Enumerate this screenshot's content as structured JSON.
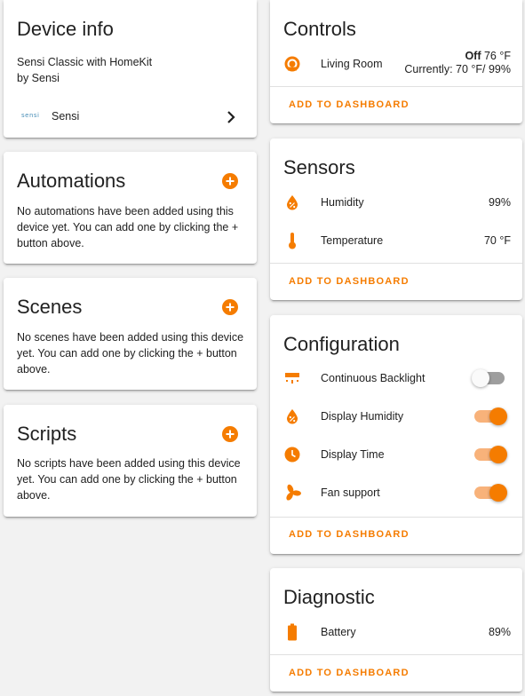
{
  "colors": {
    "accent": "#f57c00",
    "background": "#f2f2f2",
    "card": "#ffffff"
  },
  "device_info": {
    "title": "Device info",
    "model": "Sensi Classic with HomeKit",
    "manufacturer": "by Sensi",
    "integration_logo_icon": "sensi-logo-icon",
    "integration_logo_text": "sensi",
    "integration_label": "Sensi",
    "chevron_icon": "chevron-right-icon"
  },
  "automations": {
    "title": "Automations",
    "add_icon": "plus-circle-icon",
    "empty_text": "No automations have been added using this device yet. You can add one by clicking the + button above."
  },
  "scenes": {
    "title": "Scenes",
    "add_icon": "plus-circle-icon",
    "empty_text": "No scenes have been added using this device yet. You can add one by clicking the + button above."
  },
  "scripts": {
    "title": "Scripts",
    "add_icon": "plus-circle-icon",
    "empty_text": "No scripts have been added using this device yet. You can add one by clicking the + button above."
  },
  "controls": {
    "title": "Controls",
    "entities": [
      {
        "icon": "thermostat-icon",
        "label": "Living Room",
        "state": "Off",
        "target": "76 °F",
        "current": "Currently: 70 °F/ 99%"
      }
    ],
    "action": "ADD TO DASHBOARD"
  },
  "sensors": {
    "title": "Sensors",
    "entities": [
      {
        "icon": "water-percent-icon",
        "label": "Humidity",
        "value": "99%"
      },
      {
        "icon": "thermometer-icon",
        "label": "Temperature",
        "value": "70 °F"
      }
    ],
    "action": "ADD TO DASHBOARD"
  },
  "configuration": {
    "title": "Configuration",
    "entities": [
      {
        "icon": "backlight-icon",
        "label": "Continuous Backlight",
        "on": false
      },
      {
        "icon": "water-percent-icon",
        "label": "Display Humidity",
        "on": true
      },
      {
        "icon": "clock-icon",
        "label": "Display Time",
        "on": true
      },
      {
        "icon": "fan-icon",
        "label": "Fan support",
        "on": true
      }
    ],
    "action": "ADD TO DASHBOARD"
  },
  "diagnostic": {
    "title": "Diagnostic",
    "entities": [
      {
        "icon": "battery-icon",
        "label": "Battery",
        "value": "89%"
      }
    ],
    "action": "ADD TO DASHBOARD"
  }
}
